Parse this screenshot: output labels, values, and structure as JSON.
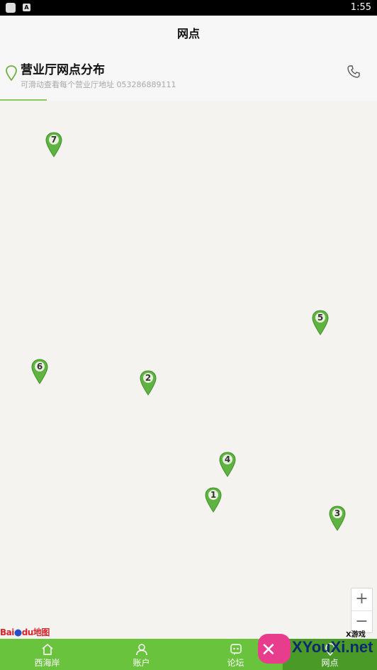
{
  "status_bar": {
    "time": "1:55",
    "badge": "A"
  },
  "header": {
    "title": "网点"
  },
  "info": {
    "heading": "营业厅网点分布",
    "subtitle": "可滑动查看每个营业厅地址  053286889111"
  },
  "map": {
    "markers": [
      {
        "label": "7"
      },
      {
        "label": "5"
      },
      {
        "label": "6"
      },
      {
        "label": "2"
      },
      {
        "label": "4"
      },
      {
        "label": "1"
      },
      {
        "label": "3"
      }
    ],
    "zoom_in": "+",
    "zoom_out": "−",
    "attribution": {
      "bai": "Bai",
      "du": "du",
      "map": "地图"
    }
  },
  "tabbar": {
    "tabs": [
      {
        "label": "西海岸",
        "icon": "home-icon"
      },
      {
        "label": "账户",
        "icon": "user-icon"
      },
      {
        "label": "论坛",
        "icon": "chat-icon"
      },
      {
        "label": "网点",
        "icon": "location-icon",
        "active": true
      }
    ]
  },
  "watermark": {
    "site": "XYouXi.net",
    "small": "X游戏"
  },
  "colors": {
    "accent": "#6ac33c",
    "active_tab": "#4a9a27",
    "marker": "#5fb341"
  }
}
